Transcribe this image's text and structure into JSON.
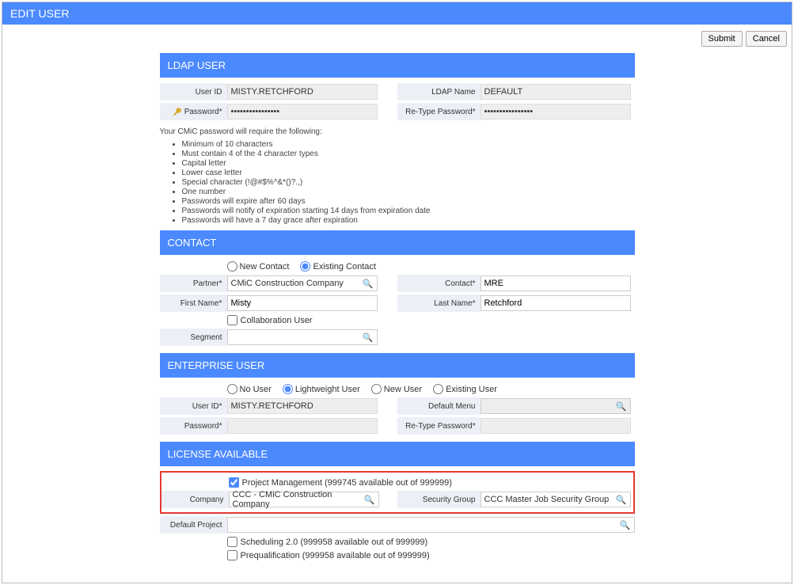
{
  "header": {
    "title": "EDIT USER"
  },
  "buttons": {
    "submit": "Submit",
    "cancel": "Cancel"
  },
  "ldap": {
    "title": "LDAP USER",
    "labels": {
      "user_id": "User ID",
      "ldap_name": "LDAP Name",
      "password": "Password*",
      "retype": "Re-Type Password*"
    },
    "user_id": "MISTY.RETCHFORD",
    "ldap_name": "DEFAULT",
    "password": "••••••••••••••••",
    "retype": "••••••••••••••••",
    "pw_intro": "Your CMiC password will require the following:",
    "pw_rules": [
      "Minimum of 10 characters",
      "Must contain 4 of the 4 character types",
      "Capital letter",
      "Lower case letter",
      "Special character (!@#$%^&*()?.,)",
      "One number",
      "Passwords will expire after 60 days",
      "Passwords will notify of expiration starting 14 days from expiration date",
      "Passwords will have a 7 day grace after expiration"
    ]
  },
  "contact": {
    "title": "CONTACT",
    "radio_new": "New Contact",
    "radio_existing": "Existing Contact",
    "labels": {
      "partner": "Partner*",
      "contact": "Contact*",
      "first_name": "First Name*",
      "last_name": "Last Name*",
      "segment": "Segment"
    },
    "partner": "CMiC Construction Company",
    "contact_val": "MRE",
    "first_name": "Misty",
    "last_name": "Retchford",
    "collab": "Collaboration User",
    "segment": ""
  },
  "enterprise": {
    "title": "ENTERPRISE USER",
    "radio_no": "No User",
    "radio_light": "Lightweight User",
    "radio_new": "New User",
    "radio_exist": "Existing User",
    "labels": {
      "user_id": "User ID*",
      "default_menu": "Default Menu",
      "password": "Password*",
      "retype": "Re-Type Password*"
    },
    "user_id": "MISTY.RETCHFORD",
    "default_menu": "",
    "password": "",
    "retype": ""
  },
  "license": {
    "title": "LICENSE AVAILABLE",
    "pm_label": "Project Management (999745 available out of 999999)",
    "labels": {
      "company": "Company",
      "security_group": "Security Group",
      "default_project": "Default Project"
    },
    "company": "CCC - CMiC Construction Company",
    "security_group": "CCC Master Job Security Group",
    "default_project": "",
    "sched_label": "Scheduling 2.0 (999958 available out of 999999)",
    "prequal_label": "Prequalification (999958 available out of 999999)"
  }
}
